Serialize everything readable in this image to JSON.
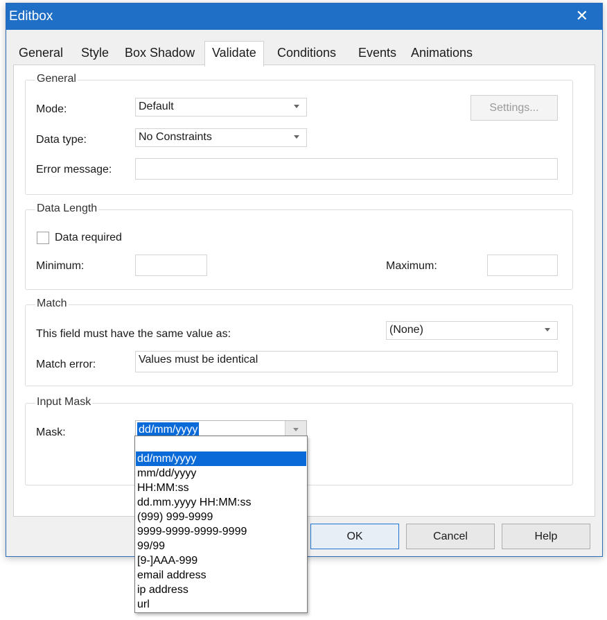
{
  "window": {
    "title": "Editbox",
    "close_glyph": "✕"
  },
  "tabs": [
    {
      "label": "General"
    },
    {
      "label": "Style"
    },
    {
      "label": "Box Shadow"
    },
    {
      "label": "Validate"
    },
    {
      "label": "Conditions"
    },
    {
      "label": "Events"
    },
    {
      "label": "Animations"
    }
  ],
  "active_tab": "Validate",
  "general": {
    "legend": "General",
    "mode_label": "Mode:",
    "mode_value": "Default",
    "datatype_label": "Data type:",
    "datatype_value": "No Constraints",
    "error_label": "Error message:",
    "error_value": "",
    "settings_button": "Settings..."
  },
  "data_length": {
    "legend": "Data Length",
    "required_label": "Data required",
    "required_checked": false,
    "minimum_label": "Minimum:",
    "minimum_value": "",
    "maximum_label": "Maximum:",
    "maximum_value": ""
  },
  "match": {
    "legend": "Match",
    "same_value_label": "This field must have the same value as:",
    "same_value_select": "(None)",
    "error_label": "Match error:",
    "error_value": "Values must be identical"
  },
  "input_mask": {
    "legend": "Input Mask",
    "mask_label": "Mask:",
    "mask_value": "dd/mm/yyyy",
    "options": [
      "",
      "dd/mm/yyyy",
      "mm/dd/yyyy",
      "HH:MM:ss",
      "dd.mm.yyyy HH:MM:ss",
      "(999) 999-9999",
      "9999-9999-9999-9999",
      "99/99",
      "[9-]AAA-999",
      "email address",
      "ip address",
      "url"
    ],
    "selected_option": "dd/mm/yyyy"
  },
  "buttons": {
    "ok": "OK",
    "cancel": "Cancel",
    "help": "Help"
  },
  "colors": {
    "titlebar": "#1f6fc6",
    "selection": "#0a6bd8",
    "default_button_border": "#1e74d2"
  },
  "icons": {
    "close": "close-icon",
    "dropdown": "chevron-down-icon"
  }
}
